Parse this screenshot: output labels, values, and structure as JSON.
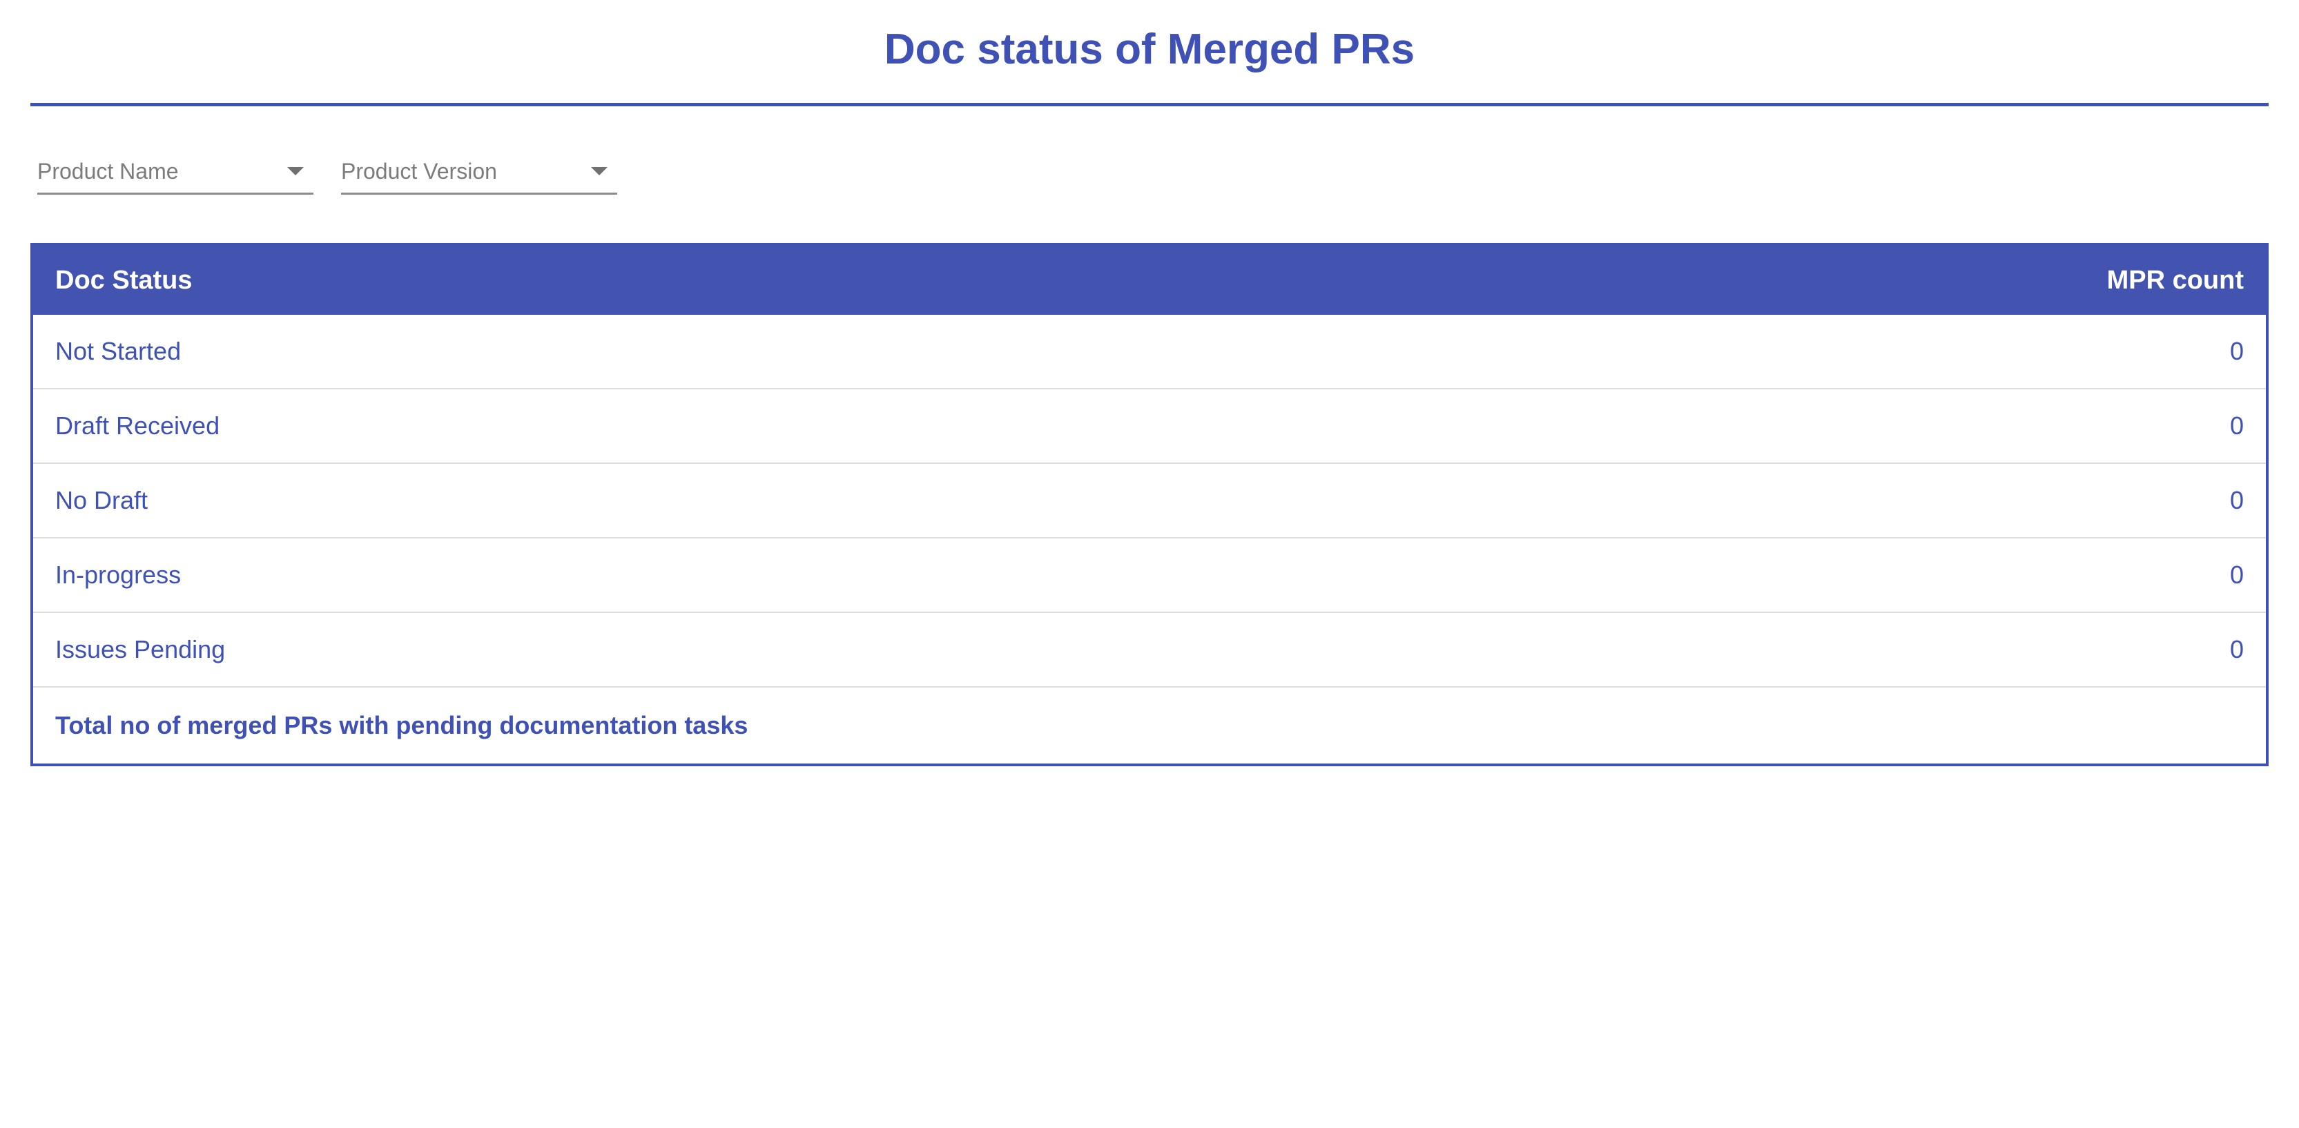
{
  "page": {
    "title": "Doc status of Merged PRs"
  },
  "filters": {
    "product_name": "Product Name",
    "product_version": "Product Version"
  },
  "table": {
    "headers": {
      "status": "Doc Status",
      "count": "MPR count"
    },
    "rows": [
      {
        "status": "Not Started",
        "count": "0"
      },
      {
        "status": "Draft Received",
        "count": "0"
      },
      {
        "status": "No Draft",
        "count": "0"
      },
      {
        "status": "In-progress",
        "count": "0"
      },
      {
        "status": "Issues Pending",
        "count": "0"
      }
    ],
    "footer": "Total no of merged PRs with pending documentation tasks"
  },
  "colors": {
    "accent": "#3f51b5",
    "header_bg": "#4354b0",
    "row_divider": "#dddddd",
    "filter_text": "#7b7b7b"
  },
  "icons": {
    "dropdown": "chevron-down-icon"
  }
}
